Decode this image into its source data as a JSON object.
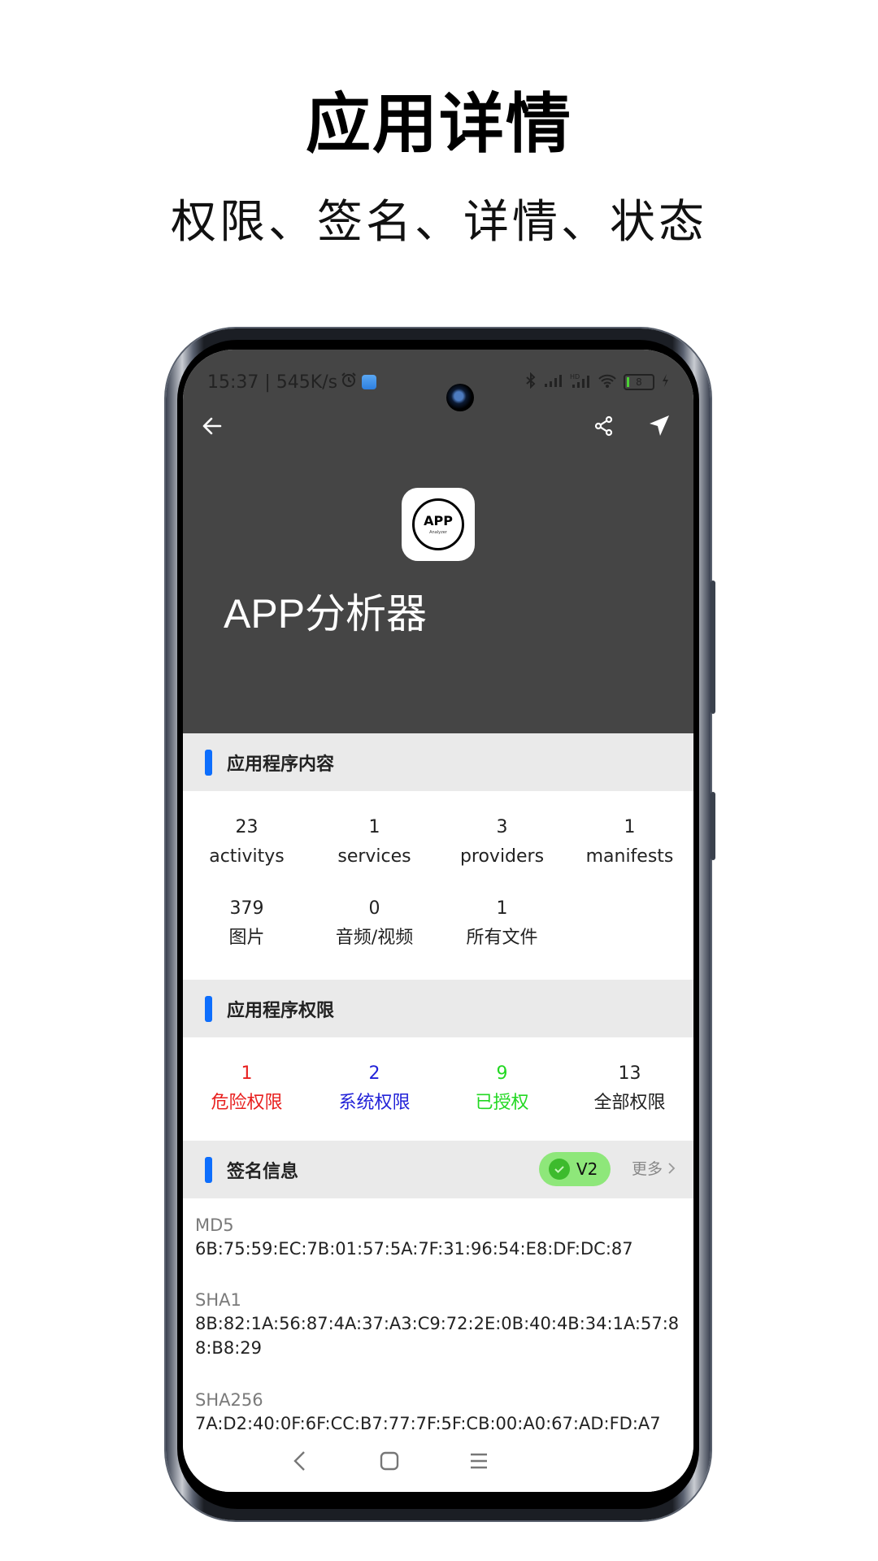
{
  "promo": {
    "title": "应用详情",
    "subtitle": "权限、签名、详情、状态"
  },
  "status_bar": {
    "time_speed": "15:37 | 545K/s",
    "battery": "8",
    "icons": [
      "alarm-icon",
      "gallery-icon",
      "bluetooth-icon",
      "signal-icon",
      "hd-signal-icon",
      "wifi-icon",
      "battery-icon",
      "charging-icon"
    ]
  },
  "toolbar": {
    "back_icon": "arrow-left-icon",
    "share_icon": "share-icon",
    "send_icon": "navigation-arrow-icon"
  },
  "app": {
    "icon_text": "APP",
    "icon_subtext": "Analyzer",
    "name": "APP分析器"
  },
  "sections": {
    "content": {
      "title": "应用程序内容",
      "items": [
        {
          "value": "23",
          "label": "activitys"
        },
        {
          "value": "1",
          "label": "services"
        },
        {
          "value": "3",
          "label": "providers"
        },
        {
          "value": "1",
          "label": "manifests"
        },
        {
          "value": "379",
          "label": "图片"
        },
        {
          "value": "0",
          "label": "音频/视频"
        },
        {
          "value": "1",
          "label": "所有文件"
        }
      ]
    },
    "permissions": {
      "title": "应用程序权限",
      "items": [
        {
          "value": "1",
          "label": "危险权限",
          "color": "#e8201f"
        },
        {
          "value": "2",
          "label": "系统权限",
          "color": "#2222d8"
        },
        {
          "value": "9",
          "label": "已授权",
          "color": "#22d822"
        },
        {
          "value": "13",
          "label": "全部权限",
          "color": "#222222"
        }
      ]
    },
    "signature": {
      "title": "签名信息",
      "badge": "V2",
      "more_label": "更多",
      "entries": [
        {
          "key": "MD5",
          "value": "6B:75:59:EC:7B:01:57:5A:7F:31:96:54:E8:DF:DC:87"
        },
        {
          "key": "SHA1",
          "value": "8B:82:1A:56:87:4A:37:A3:C9:72:2E:0B:40:4B:34:1A:57:88:B8:29"
        },
        {
          "key": "SHA256",
          "value": "7A:D2:40:0F:6F:CC:B7:77:7F:5F:CB:00:A0:67:AD:FD:A7"
        }
      ]
    }
  },
  "colors": {
    "accent": "#0d6efd",
    "hero_bg": "#454545",
    "section_bg": "#eaeaea",
    "badge_bg": "#8ee77a"
  }
}
